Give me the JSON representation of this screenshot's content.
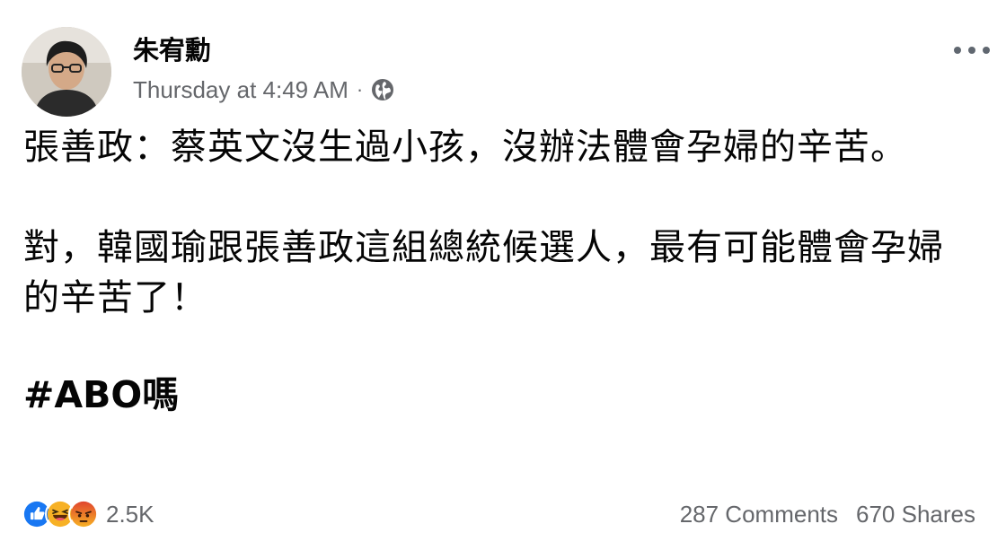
{
  "post": {
    "author": "朱宥勳",
    "timestamp": "Thursday at 4:49 AM",
    "separator": "·",
    "privacy_icon": "globe-icon",
    "paragraphs": [
      "張善政：蔡英文沒生過小孩，沒辦法體會孕婦的辛苦。",
      "對，韓國瑜跟張善政這組總統候選人，最有可能體會孕婦的辛苦了！"
    ],
    "hashtag_line": "#ABO嗎"
  },
  "engagement": {
    "reaction_icons": [
      "like-icon",
      "haha-icon",
      "angry-icon"
    ],
    "reaction_count": "2.5K",
    "comments": "287 Comments",
    "shares": "670 Shares"
  },
  "colors": {
    "text": "#050505",
    "secondary_text": "#65676b",
    "like_blue": "#1877f2",
    "haha_yellow": "#f7b125",
    "angry_orange": "#e9710f"
  }
}
